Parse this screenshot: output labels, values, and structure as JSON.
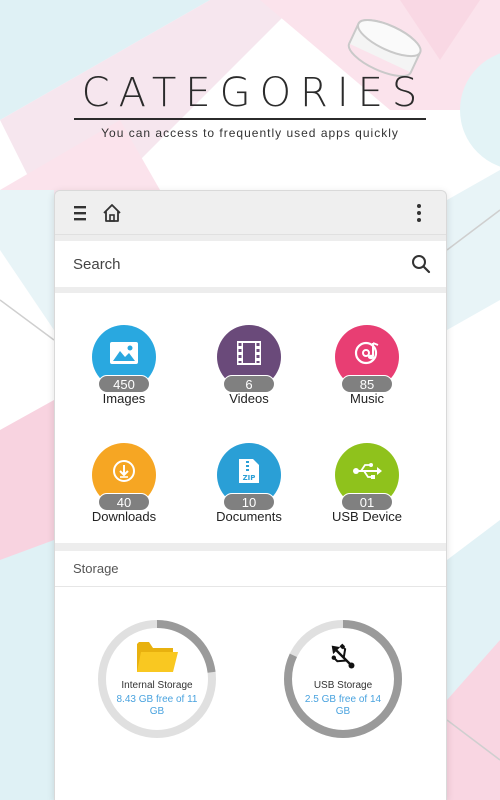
{
  "header": {
    "title": "CATEGORIES",
    "subtitle": "You can access to frequently used apps quickly"
  },
  "toolbar": {
    "menu_icon": "menu-icon",
    "home_icon": "home-icon",
    "more_icon": "more-vertical-icon"
  },
  "search": {
    "placeholder": "Search",
    "icon": "search-icon"
  },
  "categories": [
    {
      "label": "Images",
      "count": "450",
      "color": "#29a8e0",
      "icon": "image-icon"
    },
    {
      "label": "Videos",
      "count": "6",
      "color": "#6a4a7a",
      "icon": "film-icon"
    },
    {
      "label": "Music",
      "count": "85",
      "color": "#e83e73",
      "icon": "music-disc-icon"
    },
    {
      "label": "Downloads",
      "count": "40",
      "color": "#f6a623",
      "icon": "download-icon"
    },
    {
      "label": "Documents",
      "count": "10",
      "color": "#2a9fd6",
      "icon": "zip-file-icon"
    },
    {
      "label": "USB Device",
      "count": "01",
      "color": "#8fc21c",
      "icon": "usb-icon"
    }
  ],
  "storage": {
    "heading": "Storage",
    "items": [
      {
        "label": "Internal Storage",
        "free_text": "8.43 GB free of 11 GB",
        "used_fraction": 0.23,
        "icon": "folder-icon"
      },
      {
        "label": "USB Storage",
        "free_text": "2.5 GB free of 14 GB",
        "used_fraction": 0.82,
        "icon": "usb-icon"
      }
    ]
  },
  "colors": {
    "ring_track": "#e0e0e0",
    "ring_used": "#9a9a9a",
    "count_badge": "#808080",
    "free_text": "#4aa3df"
  }
}
